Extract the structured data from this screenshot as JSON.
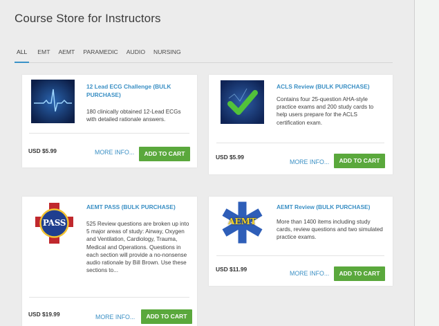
{
  "page": {
    "title": "Course Store for Instructors"
  },
  "tabs": [
    {
      "label": "ALL",
      "active": true
    },
    {
      "label": "EMT"
    },
    {
      "label": "AEMT"
    },
    {
      "label": "PARAMEDIC"
    },
    {
      "label": "AUDIO"
    },
    {
      "label": "NURSING"
    }
  ],
  "products": [
    {
      "title": "12 Lead ECG Challenge (BULK PURCHASE)",
      "description": "180 clinically obtained 12-Lead ECGs with detailed rationale answers.",
      "price": "USD $5.99",
      "more_label": "MORE INFO...",
      "cart_label": "ADD TO CART",
      "icon": "ecg-heartbeat-icon"
    },
    {
      "title": "ACLS Review (BULK PURCHASE)",
      "description": "Contains four 25-question AHA-style practice exams and 200 study cards to help users prepare for the ACLS certification exam.",
      "price": "USD $5.99",
      "more_label": "MORE INFO...",
      "cart_label": "ADD TO CART",
      "icon": "checkmark-icon"
    },
    {
      "title": "AEMT PASS (BULK PURCHASE)",
      "description": "525 Review questions are broken up into 5 major areas of study: Airway, Oxygen and Ventilation, Cardiology, Trauma, Medical and Operations. Questions in each section will provide a no-nonsense audio rationale by Bill Brown. Use these sections to...",
      "price": "USD $19.99",
      "more_label": "MORE INFO...",
      "cart_label": "ADD TO CART",
      "icon": "pass-badge-icon",
      "icon_text": "PASS"
    },
    {
      "title": "AEMT Review (BULK PURCHASE)",
      "description": "More than 1400 items including study cards, review questions and two simulated practice exams.",
      "price": "USD $11.99",
      "more_label": "MORE INFO...",
      "cart_label": "ADD TO CART",
      "icon": "star-of-life-aemt-icon",
      "icon_text": "AEMT"
    }
  ],
  "colors": {
    "accent": "#3a8fc4",
    "cart_button": "#5aa83c",
    "panel_bg": "#ececec"
  }
}
